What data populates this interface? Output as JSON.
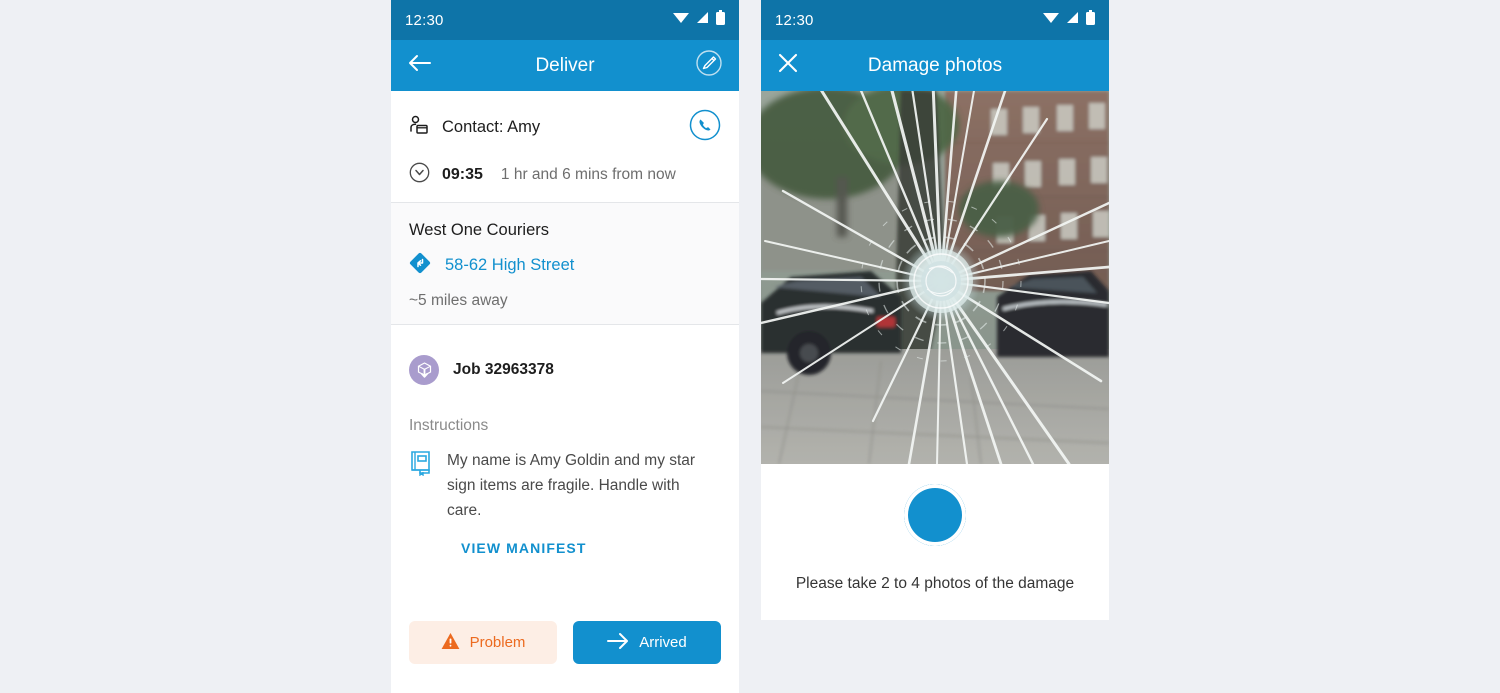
{
  "theme": {
    "status_bar_bg": "#0e74a8",
    "app_bar_bg": "#1290ce",
    "accent": "#1290ce",
    "page_bg": "#eef0f4",
    "problem_bg": "#fdeee5",
    "problem_fg": "#ec6a1f",
    "job_badge_bg": "#a99ccd"
  },
  "left_phone": {
    "status": {
      "time": "12:30",
      "icons": [
        "wifi-icon",
        "signal-icon",
        "battery-icon"
      ]
    },
    "app_bar": {
      "back_icon": "back-arrow-icon",
      "title": "Deliver",
      "action_icon": "signature-pen-icon"
    },
    "contact": {
      "icon": "contact-person-icon",
      "label": "Contact: Amy",
      "call_icon": "phone-icon"
    },
    "time_slot": {
      "icon": "clock-icon",
      "value": "09:35",
      "relative": "1 hr and 6 mins from now"
    },
    "location": {
      "company": "West One Couriers",
      "nav_icon": "directions-diamond-icon",
      "address": "58-62 High Street",
      "distance": "~5 miles away"
    },
    "job": {
      "icon": "parcel-dropoff-icon",
      "label": "Job 32963378"
    },
    "instructions": {
      "heading": "Instructions",
      "icon": "manifest-book-icon",
      "body": "My name is Amy Goldin and my star sign items are fragile. Handle with care.",
      "link_label": "VIEW MANIFEST"
    },
    "actions": {
      "problem_icon": "warning-triangle-icon",
      "problem_label": "Problem",
      "arrived_icon": "arrow-right-icon",
      "arrived_label": "Arrived"
    }
  },
  "right_phone": {
    "status": {
      "time": "12:30",
      "icons": [
        "wifi-icon",
        "signal-icon",
        "battery-icon"
      ]
    },
    "app_bar": {
      "close_icon": "close-x-icon",
      "title": "Damage photos"
    },
    "photo": {
      "alt": "Photo of a cracked vehicle windscreen with a radial impact star, street with parked cars and brick building behind"
    },
    "camera": {
      "shutter_icon": "camera-shutter-button",
      "hint": "Please take 2 to 4 photos of the damage"
    }
  }
}
